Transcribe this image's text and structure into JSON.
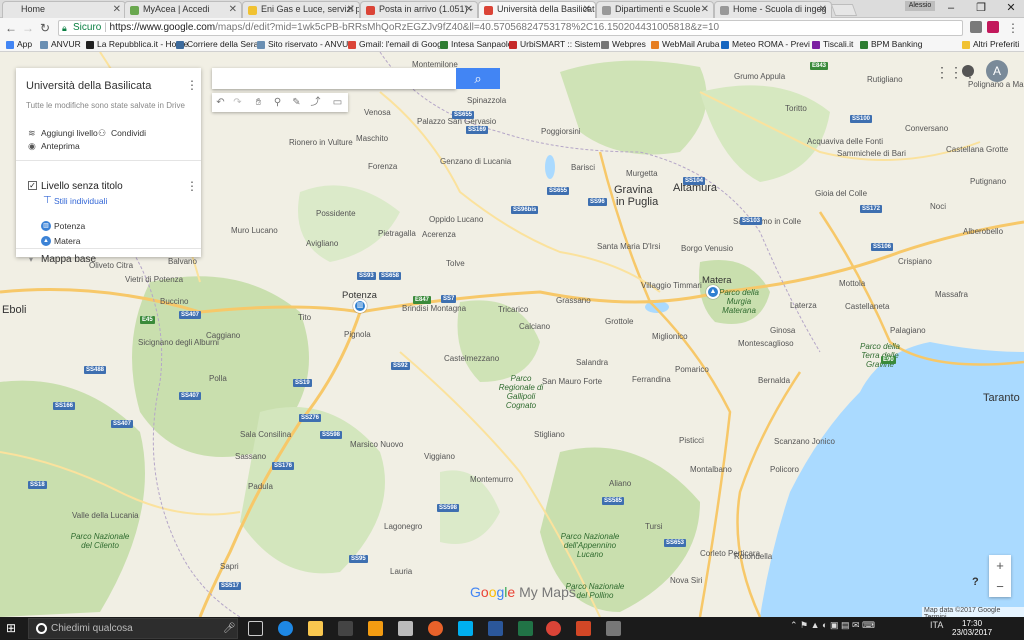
{
  "browser": {
    "tabs": [
      {
        "label": "Home",
        "color": "#888888"
      },
      {
        "label": "MyAcea | Accedi",
        "color": "#6aa84f"
      },
      {
        "label": "Eni Gas e Luce, servizi pe",
        "color": "#f1c232"
      },
      {
        "label": "Posta in arrivo (1.051) - ",
        "color": "#db4437"
      },
      {
        "label": "Università della Basilicata",
        "color": "#db4437"
      },
      {
        "label": "Dipartimenti e Scuole - ",
        "color": "#888888"
      },
      {
        "label": "Home - Scuola di ingeg",
        "color": "#888888"
      }
    ],
    "user_label": "Alessio",
    "window_controls": {
      "minimize": "–",
      "maximize": "❐",
      "close": "✕"
    },
    "secure_label": "Sicuro",
    "url_host": "https://www.google.com",
    "url_path": "/maps/d/edit?mid=1wk5cPB-bRRsMhQoRzEGZJv9fZ40&ll=40.57056824753178%2C16.150204431005818&z=10",
    "bookmarks": [
      {
        "label": "App",
        "color": "#4285f4"
      },
      {
        "label": "ANVUR",
        "color": "#6a8fb3"
      },
      {
        "label": "La Repubblica.it - Home",
        "color": "#222222"
      },
      {
        "label": "Corriere della Sera",
        "color": "#3d6b9c"
      },
      {
        "label": "Sito riservato - ANVU",
        "color": "#6a8fb3"
      },
      {
        "label": "Gmail: l'email di Goog",
        "color": "#db4437"
      },
      {
        "label": "Intesa Sanpaolo",
        "color": "#2e7d32"
      },
      {
        "label": "UrbiSMART :: Sistem",
        "color": "#c62828"
      },
      {
        "label": "Webpres",
        "color": "#777777"
      },
      {
        "label": "WebMail Aruba",
        "color": "#e67e22"
      },
      {
        "label": "Meteo ROMA - Previ",
        "color": "#1565c0"
      },
      {
        "label": "Tiscali.it",
        "color": "#7b1fa2"
      },
      {
        "label": "BPM Banking",
        "color": "#2e7d32"
      }
    ],
    "other_bookmarks": "Altri Preferiti"
  },
  "mymaps": {
    "title": "Università della Basilicata",
    "saved_status": "Tutte le modifiche sono state salvate in Drive",
    "add_layer": "Aggiungi livello",
    "share": "Condividi",
    "preview": "Anteprima",
    "layer_title": "Livello senza titolo",
    "layer_style": "Stili individuali",
    "items": [
      {
        "label": "Potenza",
        "icon": "building-icon"
      },
      {
        "label": "Matera",
        "icon": "graduation-cap-icon"
      }
    ],
    "base_map": "Mappa base",
    "search_placeholder": "",
    "avatar_letter": "A",
    "zoom_in": "+",
    "zoom_out": "−",
    "help": "?",
    "logo": {
      "g1": "G",
      "o1": "o",
      "o2": "o",
      "g2": "g",
      "l": "l",
      "e": "e",
      "rest": " My Maps"
    },
    "map_data": "Map data ©2017 Google   Termini"
  },
  "map_labels": {
    "cities": [
      {
        "name": "Potenza"
      },
      {
        "name": "Matera"
      },
      {
        "name": "Altamura"
      },
      {
        "name": "Gravina"
      },
      {
        "name": "in Puglia"
      },
      {
        "name": "Taranto"
      },
      {
        "name": "Eboli"
      }
    ],
    "towns": [
      "Montemilone",
      "Spinazzola",
      "Venosa",
      "Palazzo San Gervasio",
      "Maschito",
      "Rionero in Vulture",
      "Forenza",
      "Genzano di Lucania",
      "Poggiorsini",
      "Barisci",
      "Murgetta",
      "Grumo Appula",
      "Toritto",
      "Rutigliano",
      "Polignano a Mare",
      "Conversano",
      "Acquaviva delle Fonti",
      "Sammichele di Bari",
      "Castellana Grotte",
      "Putignano",
      "Gioia del Colle",
      "Noci",
      "Alberobello",
      "Santeramo in Colle",
      "Oppido Lucano",
      "Acerenza",
      "Possidente",
      "Pietragalla",
      "Avigliano",
      "Muro Lucano",
      "Balvano",
      "Vietri di Potenza",
      "Buccino",
      "Oliveto Citra",
      "Tolve",
      "Santa Maria D'Irsi",
      "Borgo Venusio",
      "Villaggio Timmari",
      "Grassano",
      "Miglionico",
      "Montescaglioso",
      "Laterza",
      "Ginosa",
      "Castellaneta",
      "Mottola",
      "Palagiano",
      "Crispiano",
      "Massafra",
      "Pignola",
      "Brindisi Montagna",
      "Tricarico",
      "Calciano",
      "Grottole",
      "Salandra",
      "Ferrandina",
      "Pomarico",
      "Bernalda",
      "Pisticci",
      "Montalbano",
      "Policoro",
      "Scanzano Jonico",
      "Castelmezzano",
      "San Mauro Forte",
      "Stigliano",
      "Aliano",
      "Sala Consilina",
      "Padula",
      "Caggiano",
      "Polla",
      "Sassano",
      "Tito",
      "Sicignano degli Alburni",
      "Valle della Lucania",
      "Tursi",
      "Rotondella",
      "Nova Siri",
      "Lauria",
      "Sapri",
      "Lagonegro",
      "Marsico Nuovo",
      "Viggiano",
      "Montemurro",
      "Corleto Perticara",
      "Colobraro"
    ],
    "parks": [
      "Parco della Murgia Materana",
      "Parco Regionale di Gallipoli Cognato",
      "Parco Nazionale del Cilento",
      "Parco Nazionale dell'Appennino Lucano",
      "Parco Nazionale del Pollino",
      "Parco della Terra delle Gravine"
    ],
    "roads": [
      "SS655",
      "SS169",
      "SS96",
      "SS96bis",
      "SS7",
      "E847",
      "SS93",
      "SS658",
      "SS407",
      "E90",
      "SS7",
      "SS598",
      "SS92",
      "SS19",
      "SS103",
      "SS104",
      "SS100",
      "SS172",
      "SS106",
      "E843",
      "SS653",
      "SS598",
      "SS517",
      "SS18",
      "SS166",
      "SS488",
      "SS407",
      "SS407",
      "E45",
      "SS176",
      "SS276",
      "SS95",
      "SS585"
    ]
  }
}
